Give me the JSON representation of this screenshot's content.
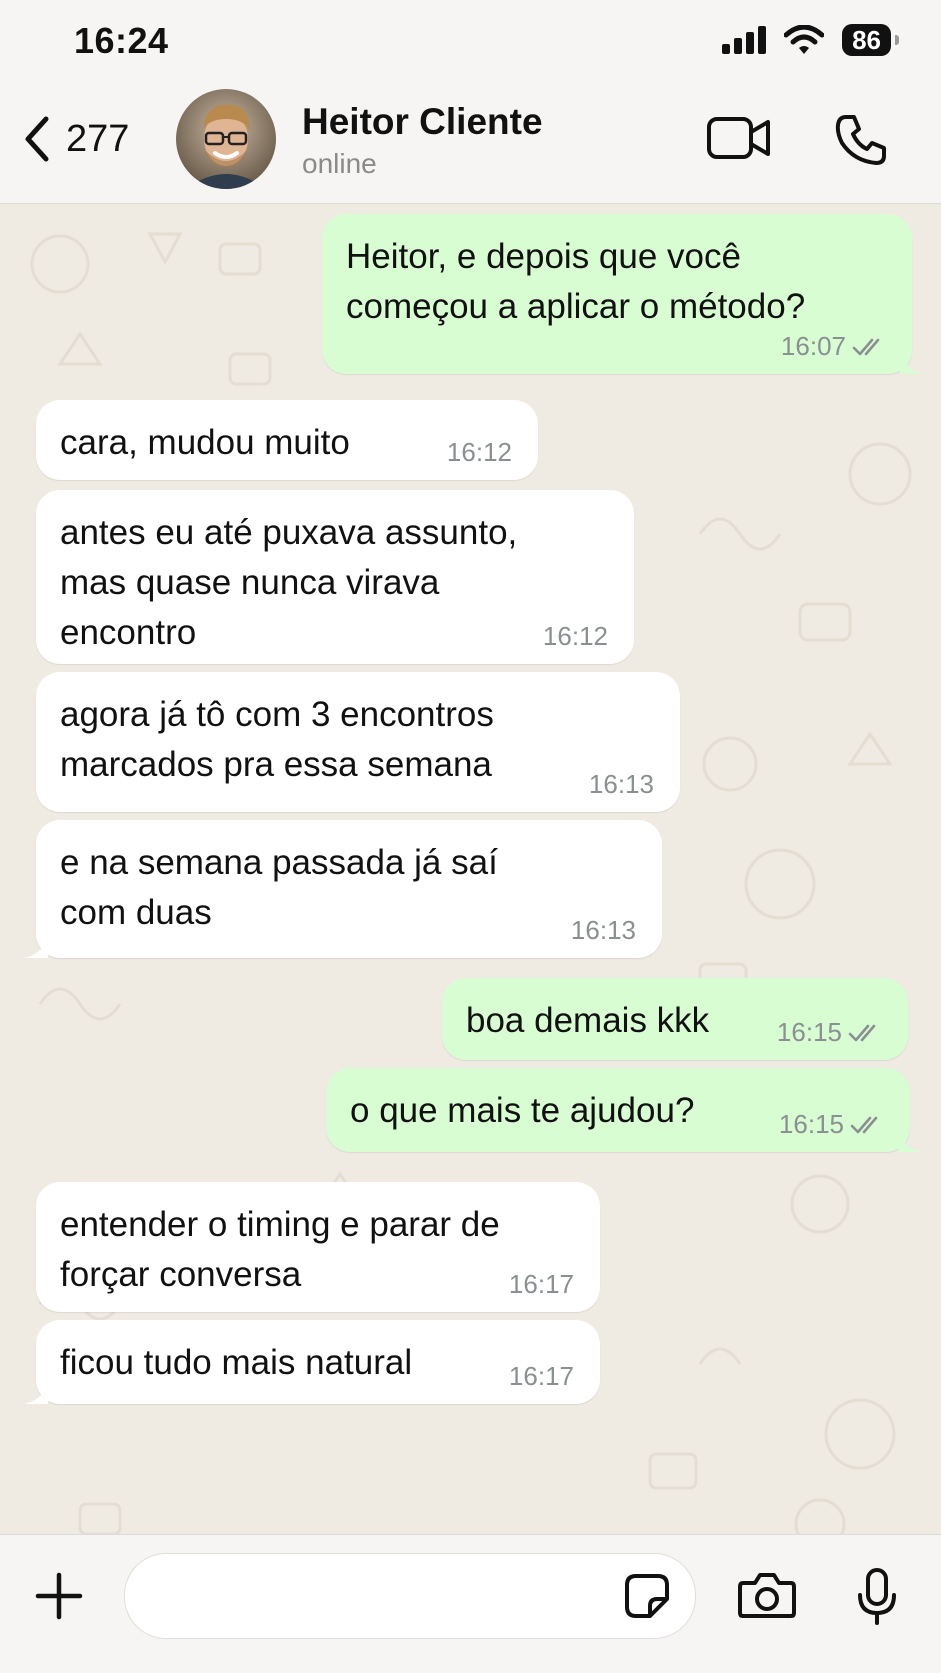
{
  "status_bar": {
    "time": "16:24",
    "battery": "86",
    "icons": [
      "signal-icon",
      "wifi-icon",
      "battery-icon"
    ]
  },
  "header": {
    "back_count": "277",
    "contact_name": "Heitor Cliente",
    "contact_status": "online",
    "icons": [
      "back-chevron-icon",
      "avatar",
      "video-call-icon",
      "voice-call-icon"
    ]
  },
  "messages": [
    {
      "dir": "out",
      "text": "Heitor, e depois que você\ncomeçou a aplicar o método?",
      "time": "16:07",
      "read": true
    },
    {
      "dir": "in",
      "text": "cara, mudou muito",
      "time": "16:12"
    },
    {
      "dir": "in",
      "text": "antes eu até puxava assunto,\nmas quase nunca virava\nencontro",
      "time": "16:12"
    },
    {
      "dir": "in",
      "text": "agora já tô com 3 encontros\nmarcados pra essa semana",
      "time": "16:13"
    },
    {
      "dir": "in",
      "text": "e na semana passada já saí\ncom duas",
      "time": "16:13"
    },
    {
      "dir": "out",
      "text": "boa demais kkk",
      "time": "16:15",
      "read": true
    },
    {
      "dir": "out",
      "text": "o que mais te ajudou?",
      "time": "16:15",
      "read": true
    },
    {
      "dir": "in",
      "text": "entender o timing e parar de\nforçar conversa",
      "time": "16:17"
    },
    {
      "dir": "in",
      "text": "ficou tudo mais natural",
      "time": "16:17"
    }
  ],
  "composer": {
    "message_value": "",
    "icons": [
      "plus-icon",
      "sticker-icon",
      "camera-icon",
      "microphone-icon"
    ]
  },
  "colors": {
    "outgoing_bubble": "#d9fdd3",
    "incoming_bubble": "#ffffff",
    "wallpaper": "#efeae2",
    "read_ticks": "#8a8f92"
  }
}
